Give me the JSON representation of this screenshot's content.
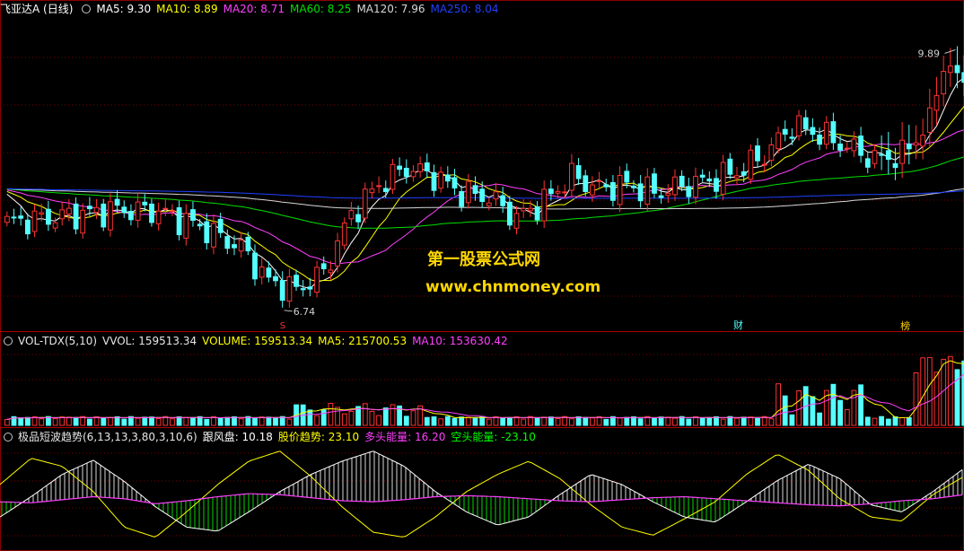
{
  "colors": {
    "bg": "#000000",
    "grid": "#7a0000",
    "up": "#ff3232",
    "down": "#54ffff",
    "ma5": "#ffffff",
    "ma10": "#ffff00",
    "ma20": "#ff40ff",
    "ma60": "#00e000",
    "ma120": "#d8d8d8",
    "ma250": "#2040ff",
    "cyan": "#00ffff",
    "purple": "#c040ff"
  },
  "main": {
    "title": "飞亚达A (日线)",
    "ma5": "MA5: 9.30",
    "ma10": "MA10: 8.89",
    "ma20": "MA20: 8.71",
    "ma60": "MA60: 8.25",
    "ma120": "MA120: 7.96",
    "ma250": "MA250: 8.04",
    "high_label": "9.89",
    "low_label": "6.74",
    "mark_s": "S",
    "mark_cai": "财",
    "mark_bang": "榜"
  },
  "volume": {
    "name": "VOL-TDX(5,10)",
    "vvol": "VVOL: 159513.34",
    "vol": "VOLUME: 159513.34",
    "ma5": "MA5: 215700.53",
    "ma10": "MA10: 153630.42"
  },
  "indicator": {
    "name": "极品短波趋势(6,13,13,3,80,3,10,6)",
    "gf": "跟风盘: 10.18",
    "trend": "股价趋势: 23.10",
    "long": "多头能量: 16.20",
    "short": "空头能量: -23.10"
  },
  "watermark": {
    "line1": "第一股票公式网",
    "line2": "www.chnmoney.com"
  },
  "chart_data": {
    "type": "candlestick",
    "price_axis": [
      6.4,
      10.1
    ],
    "low": 6.74,
    "high": 9.89,
    "anchors": [
      [
        0,
        7.65
      ],
      [
        8,
        7.72
      ],
      [
        16,
        7.8
      ],
      [
        22,
        7.78
      ],
      [
        28,
        7.6
      ],
      [
        34,
        7.35
      ],
      [
        38,
        6.95
      ],
      [
        42,
        6.85
      ],
      [
        46,
        7.05
      ],
      [
        50,
        7.75
      ],
      [
        54,
        8.1
      ],
      [
        58,
        8.3
      ],
      [
        62,
        8.2
      ],
      [
        66,
        8.0
      ],
      [
        70,
        7.95
      ],
      [
        74,
        7.7
      ],
      [
        78,
        7.9
      ],
      [
        82,
        8.2
      ],
      [
        86,
        8.05
      ],
      [
        90,
        8.1
      ],
      [
        94,
        8.0
      ],
      [
        98,
        8.08
      ],
      [
        102,
        8.15
      ],
      [
        106,
        8.25
      ],
      [
        110,
        8.45
      ],
      [
        114,
        8.8
      ],
      [
        118,
        8.7
      ],
      [
        122,
        8.55
      ],
      [
        126,
        8.4
      ],
      [
        130,
        8.45
      ],
      [
        134,
        8.85
      ],
      [
        136,
        9.55
      ],
      [
        138,
        9.35
      ]
    ],
    "series": [
      {
        "name": "MA5",
        "period": 5
      },
      {
        "name": "MA10",
        "period": 10
      },
      {
        "name": "MA20",
        "period": 20
      },
      {
        "name": "MA60",
        "period": 60
      },
      {
        "name": "MA120",
        "period": 120
      },
      {
        "name": "MA250",
        "period": 250
      }
    ],
    "indicator_lines": {
      "yellow_y": [
        0.62,
        0.88,
        0.8,
        0.55,
        0.2,
        0.1,
        0.35,
        0.62,
        0.85,
        0.95,
        0.7,
        0.4,
        0.15,
        0.1,
        0.3,
        0.55,
        0.72,
        0.85,
        0.68,
        0.42,
        0.2,
        0.12,
        0.28,
        0.45,
        0.72,
        0.92,
        0.76,
        0.48,
        0.3,
        0.26,
        0.52,
        0.7
      ],
      "white_y": [
        0.3,
        0.5,
        0.72,
        0.86,
        0.65,
        0.4,
        0.2,
        0.16,
        0.35,
        0.55,
        0.72,
        0.85,
        0.95,
        0.8,
        0.55,
        0.35,
        0.22,
        0.3,
        0.52,
        0.72,
        0.62,
        0.45,
        0.3,
        0.25,
        0.45,
        0.66,
        0.82,
        0.68,
        0.42,
        0.35,
        0.55,
        0.78
      ],
      "magenta_y": [
        0.45,
        0.44,
        0.47,
        0.5,
        0.48,
        0.43,
        0.46,
        0.5,
        0.53,
        0.52,
        0.49,
        0.46,
        0.45,
        0.47,
        0.5,
        0.51,
        0.5,
        0.48,
        0.46,
        0.45,
        0.47,
        0.49,
        0.5,
        0.48,
        0.46,
        0.44,
        0.42,
        0.41,
        0.43,
        0.46,
        0.48,
        0.52
      ]
    }
  }
}
